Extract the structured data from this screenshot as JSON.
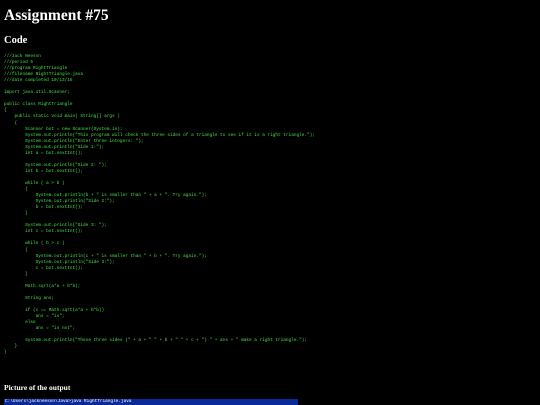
{
  "page": {
    "title": "Assignment #75",
    "code_heading": "Code",
    "output_heading": "Picture of the output"
  },
  "code": {
    "lines": [
      "///Jack Neeson",
      "///period 5",
      "///program RightTriangle",
      "///filename RightTriangle.java",
      "///date completed 10/13/15",
      "",
      "import java.util.Scanner;",
      "",
      "public class RightTriangle",
      "{",
      "    public static void main( String[] args )",
      "    {",
      "        Scanner bot = new Scanner(System.in);",
      "        System.out.println(\"This program will check the three sides of a triangle to see if it is a right triangle.\");",
      "        System.out.println(\"Enter three integers: \");",
      "        System.out.println(\"Side 1:\");",
      "        int a = bot.nextInt();",
      "",
      "        System.out.println(\"Side 2: \");",
      "        int b = bot.nextInt();",
      "",
      "        while ( a > b )",
      "        {",
      "            System.out.println(b + \" is smaller than \" + a + \". Try again.\");",
      "            System.out.println(\"Side 2:\");",
      "            b = bot.nextInt();",
      "        }",
      "",
      "        System.out.println(\"Side 3: \");",
      "        int c = bot.nextInt();",
      "",
      "        while ( b > c )",
      "        {",
      "            System.out.println(c + \" is smaller than \" + b + \". Try again.\");",
      "            System.out.println(\"Side 3:\");",
      "            c = bot.nextInt();",
      "        }",
      "",
      "        Math.sqrt(a*a + b*b);",
      "",
      "        String ans;",
      "",
      "        if (c == Math.sqrt(a*a + b*b))",
      "            ans = \"is\";",
      "        else",
      "            ans = \"is not\";",
      "",
      "        System.out.println(\"These three sides (\" + a + \" \" + b + \" \" + c + \") \" + ans + \" make a right triangle.\");",
      "    }",
      "}"
    ]
  },
  "output": {
    "command_line": "C:\\Users\\jackneeson\\Java>java RightTriangle.java"
  },
  "colors": {
    "background": "#000000",
    "heading_text": "#ffffff",
    "code_text": "#48e048",
    "output_bar": "#0a2a9c"
  }
}
